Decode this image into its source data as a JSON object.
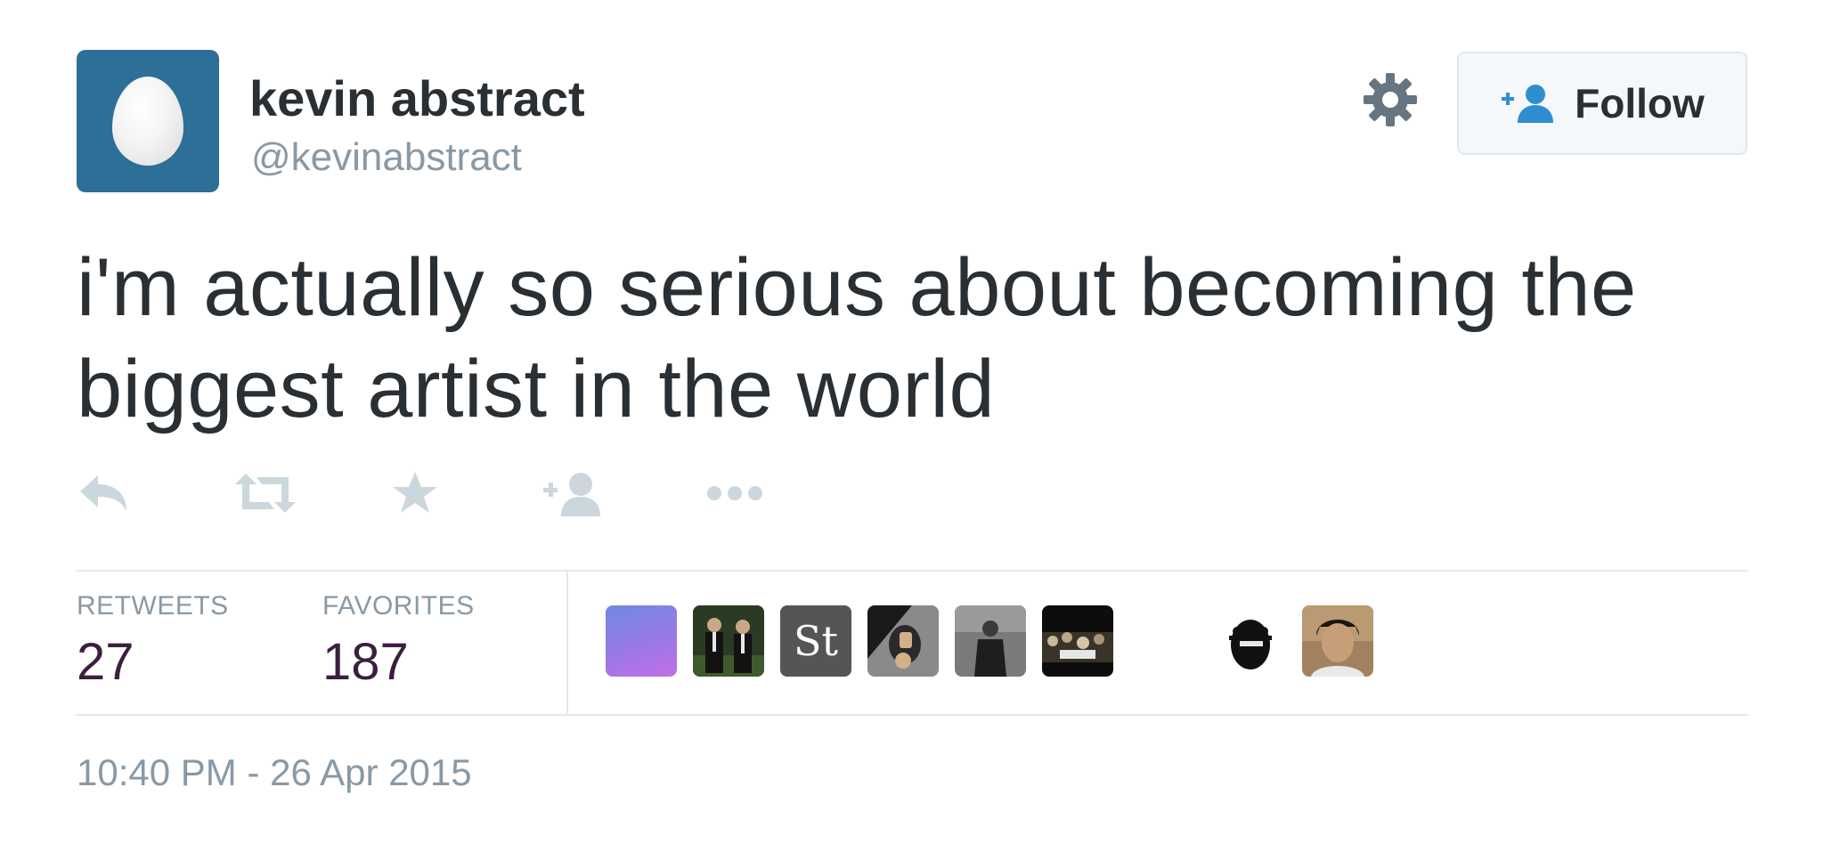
{
  "user": {
    "name": "kevin abstract",
    "handle": "@kevinabstract",
    "avatar_icon": "default-egg-avatar",
    "avatar_color": "#2e6f98"
  },
  "header": {
    "settings_icon": "gear-icon",
    "follow_button": {
      "label": "Follow",
      "icon": "add-user-icon"
    }
  },
  "tweet": {
    "text": "i'm actually so serious about becoming the biggest artist in the world",
    "timestamp": "10:40 PM - 26 Apr 2015"
  },
  "actions": [
    {
      "name": "reply",
      "icon": "reply-icon"
    },
    {
      "name": "retweet",
      "icon": "retweet-icon"
    },
    {
      "name": "favorite",
      "icon": "star-icon"
    },
    {
      "name": "follow",
      "icon": "add-user-icon"
    },
    {
      "name": "more",
      "icon": "more-dots-icon"
    }
  ],
  "stats": {
    "retweets_label": "RETWEETS",
    "retweets_count": "27",
    "favorites_label": "FAVORITES",
    "favorites_count": "187"
  },
  "favoriters": [
    {
      "name": "favoriter-avatar-1",
      "kind": "purple gradient"
    },
    {
      "name": "favoriter-avatar-2",
      "kind": "two men in suits"
    },
    {
      "name": "favoriter-avatar-3",
      "kind": "St logo"
    },
    {
      "name": "favoriter-avatar-4",
      "kind": "selfie"
    },
    {
      "name": "favoriter-avatar-5",
      "kind": "person in dark"
    },
    {
      "name": "favoriter-avatar-6",
      "kind": "crowd"
    },
    {
      "name": "favoriter-avatar-7",
      "kind": "masked figure"
    },
    {
      "name": "favoriter-avatar-8",
      "kind": "portrait"
    }
  ],
  "colors": {
    "text": "#292f33",
    "muted": "#8899a6",
    "action_icon": "#ccd6dd",
    "stat_value": "#3b1f3f",
    "border": "#e1e8ed",
    "link": "#2e8ecf"
  }
}
